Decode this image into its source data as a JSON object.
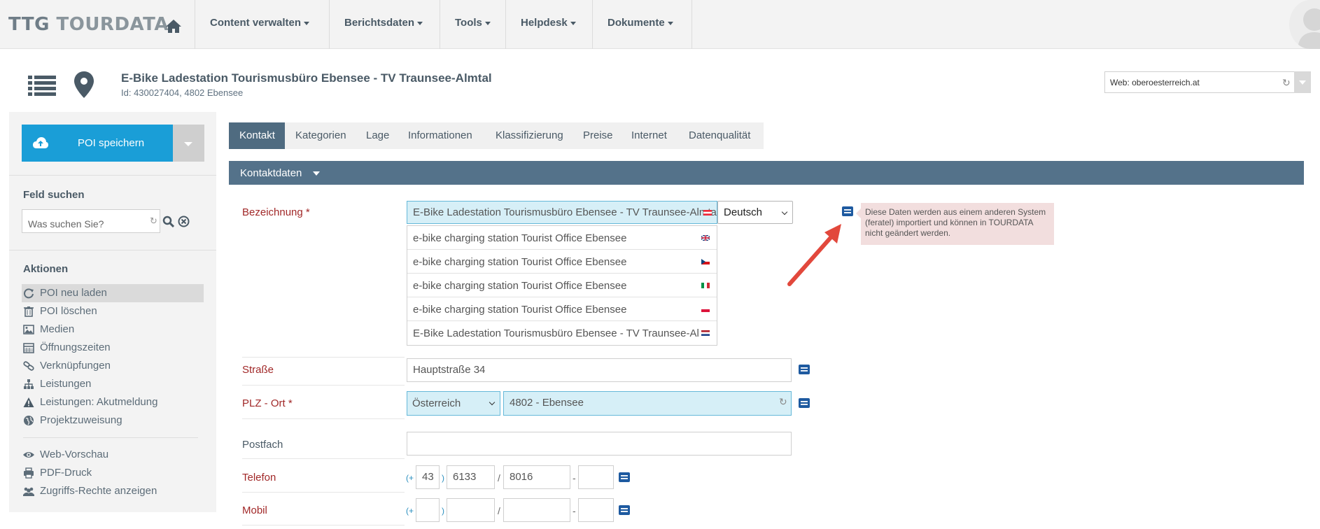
{
  "brand": {
    "ttg": "TTG",
    "tour": "TOURDATA"
  },
  "nav": {
    "items": [
      {
        "label": "Content verwalten"
      },
      {
        "label": "Berichtsdaten"
      },
      {
        "label": "Tools"
      },
      {
        "label": "Helpdesk"
      },
      {
        "label": "Dokumente"
      }
    ]
  },
  "header": {
    "title": "E-Bike Ladestation Tourismusbüro Ebensee - TV Traunsee-Almtal",
    "subtitle": "Id: 430027404, 4802 Ebensee",
    "web_select": "Web: oberoesterreich.at"
  },
  "sidebar": {
    "save_label": "POI speichern",
    "search_heading": "Feld suchen",
    "search_placeholder": "Was suchen Sie?",
    "actions_heading": "Aktionen",
    "actions": [
      {
        "label": "POI neu laden",
        "icon": "refresh-icon"
      },
      {
        "label": "POI löschen",
        "icon": "trash-icon"
      },
      {
        "label": "Medien",
        "icon": "image-icon"
      },
      {
        "label": "Öffnungszeiten",
        "icon": "calendar-icon"
      },
      {
        "label": "Verknüpfungen",
        "icon": "link-icon"
      },
      {
        "label": "Leistungen",
        "icon": "sitemap-icon"
      },
      {
        "label": "Leistungen: Akutmeldung",
        "icon": "warning-icon"
      },
      {
        "label": "Projektzuweisung",
        "icon": "globe-icon"
      }
    ],
    "extras": [
      {
        "label": "Web-Vorschau",
        "icon": "eye-icon"
      },
      {
        "label": "PDF-Druck",
        "icon": "print-icon"
      },
      {
        "label": "Zugriffs-Rechte anzeigen",
        "icon": "users-icon"
      }
    ]
  },
  "tabs": [
    {
      "label": "Kontakt"
    },
    {
      "label": "Kategorien"
    },
    {
      "label": "Lage"
    },
    {
      "label": "Informationen"
    },
    {
      "label": "Klassifizierung"
    },
    {
      "label": "Preise"
    },
    {
      "label": "Internet"
    },
    {
      "label": "Datenqualität"
    }
  ],
  "section": {
    "label": "Kontaktdaten"
  },
  "form": {
    "bezeichnung": {
      "label": "Bezeichnung *",
      "value": "E-Bike Ladestation Tourismusbüro Ebensee - TV Traunsee-Almtal",
      "language": "Deutsch",
      "translations": [
        {
          "value": "e-bike charging station Tourist Office Ebensee",
          "flag": "uk-flag-icon"
        },
        {
          "value": "e-bike charging station Tourist Office Ebensee",
          "flag": "czech-flag-icon"
        },
        {
          "value": "e-bike charging station Tourist Office Ebensee",
          "flag": "italy-flag-icon"
        },
        {
          "value": "e-bike charging station Tourist Office Ebensee",
          "flag": "poland-flag-icon"
        },
        {
          "value": "E-Bike Ladestation Tourismusbüro Ebensee - TV Traunsee-Almtal",
          "flag": "netherlands-flag-icon"
        }
      ],
      "tooltip": "Diese Daten werden aus einem anderen System (feratel) importiert und können in TOURDATA nicht geändert werden."
    },
    "strasse": {
      "label": "Straße",
      "value": "Hauptstraße 34"
    },
    "plz_ort": {
      "label": "PLZ - Ort *",
      "country": "Österreich",
      "value": "4802 - Ebensee"
    },
    "postfach": {
      "label": "Postfach",
      "value": ""
    },
    "telefon": {
      "label": "Telefon",
      "prefix": "(+",
      "country_code": "43",
      "close": ")",
      "area": "6133",
      "slash": "/",
      "number": "8016",
      "dash": "-",
      "ext": ""
    },
    "mobil": {
      "label": "Mobil",
      "prefix": "(+",
      "country_code": "",
      "close": ")",
      "area": "",
      "slash": "/",
      "number": "",
      "dash": "-",
      "ext": ""
    }
  }
}
